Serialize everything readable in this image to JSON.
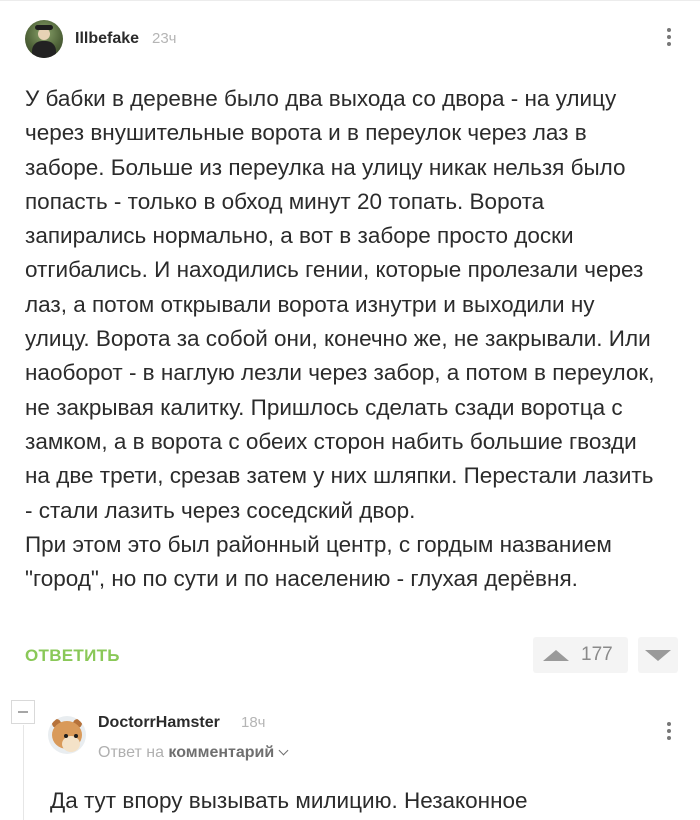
{
  "comments": [
    {
      "author": "Illbefake",
      "time": "23ч",
      "text": "У бабки в деревне было два выхода со двора - на улицу через внушительные ворота и в переулок через лаз в заборе. Больше из переулка на улицу никак нельзя было попасть - только в обход минут 20 топать. Ворота запирались нормально, а вот в заборе просто доски отгибались. И находились гении, которые пролезали через лаз, а потом открывали ворота изнутри и выходили ну улицу. Ворота за собой они, конечно же, не закрывали. Или наоборот - в наглую лезли через забор, а потом в переулок, не закрывая калитку. Пришлось сделать сзади воротца с замком, а в ворота с обеих сторон набить большие гвозди на две трети, срезав затем у них шляпки. Перестали лазить - стали лазить через соседский двор.\nПри этом это был районный центр, с гордым названием \"город\", но по сути и по населению - глухая дерёвня.",
      "reply_label": "ОТВЕТИТЬ",
      "rating": "177"
    },
    {
      "author": "DoctorrHamster",
      "time": "18ч",
      "reply_prefix": "Ответ на",
      "reply_target": "комментарий",
      "text": "Да тут впору вызывать милицию. Незаконное"
    }
  ],
  "icons": {
    "more": "vertical-dots-icon",
    "vote_up": "triangle-up-icon",
    "vote_down": "triangle-down-icon",
    "collapse": "minus-square-icon",
    "reply_expand": "chevron-down-icon"
  },
  "colors": {
    "reply_link": "#8ac858",
    "text": "#2b2b2b",
    "muted": "#b0b0b0",
    "vote_bg": "#f4f4f4"
  }
}
